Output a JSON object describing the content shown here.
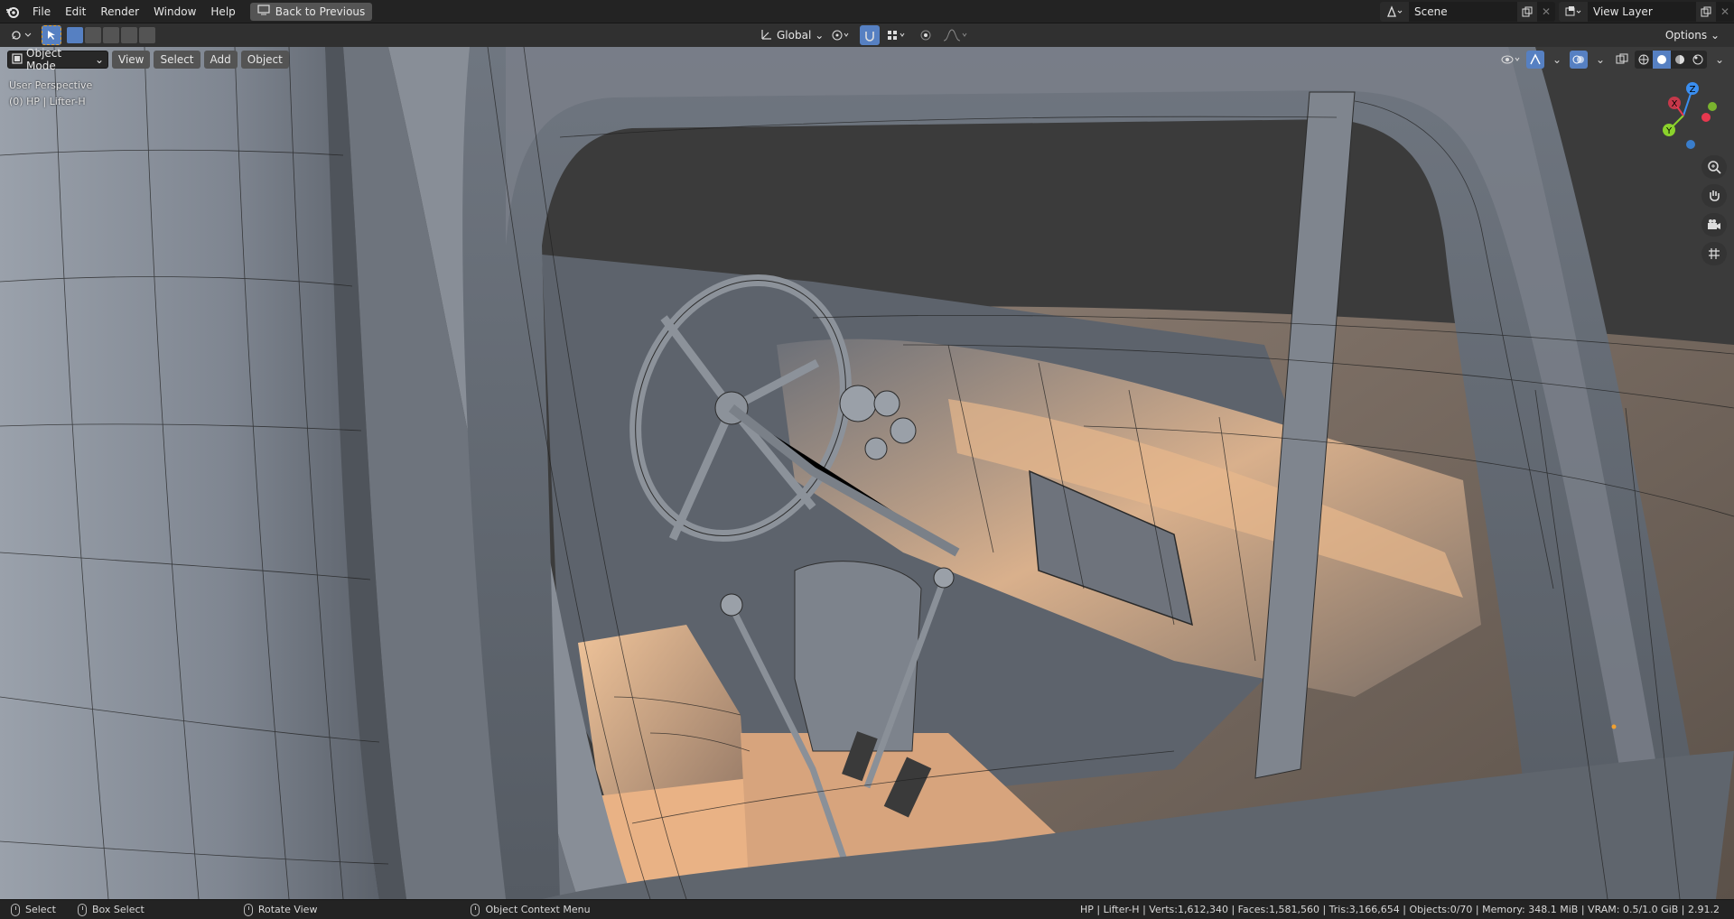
{
  "menubar": {
    "items": [
      "File",
      "Edit",
      "Render",
      "Window",
      "Help"
    ],
    "back_button": "Back to Previous",
    "scene_name": "Scene",
    "view_layer_name": "View Layer"
  },
  "tool_header": {
    "transform_orientation": "Global",
    "options_label": "Options"
  },
  "viewport": {
    "mode": "Object Mode",
    "menus": [
      "View",
      "Select",
      "Add",
      "Object"
    ],
    "perspective_label": "User Perspective",
    "active_object_label": "(0) HP | Lifter-H",
    "gizmo_axes": [
      "X",
      "Y",
      "Z"
    ]
  },
  "statusbar": {
    "select": "Select",
    "box_select": "Box Select",
    "rotate_view": "Rotate View",
    "context_menu": "Object Context Menu",
    "stats": "HP | Lifter-H | Verts:1,612,340 | Faces:1,581,560 | Tris:3,166,654 | Objects:0/70 | Memory: 348.1 MiB | VRAM: 0.5/1.0 GiB | 2.91.2"
  },
  "colors": {
    "accent": "#5680c2",
    "header": "#303030",
    "menubar": "#232323",
    "viewport_bg": "#3b3b3b",
    "axis_x": "#e8384f",
    "axis_y": "#8bd22c",
    "axis_z": "#3a8ef0"
  },
  "icons": [
    "blender-logo-icon",
    "select-tool-icon",
    "transform-orientation-icon",
    "pivot-icon",
    "snap-icon",
    "proportional-icon",
    "visibility-icon",
    "gizmo-toggle-icon",
    "overlay-icon",
    "xray-icon",
    "wireframe-shading-icon",
    "solid-shading-icon",
    "material-shading-icon",
    "rendered-shading-icon",
    "zoom-icon",
    "hand-pan-icon",
    "camera-icon",
    "grid-ortho-icon"
  ]
}
